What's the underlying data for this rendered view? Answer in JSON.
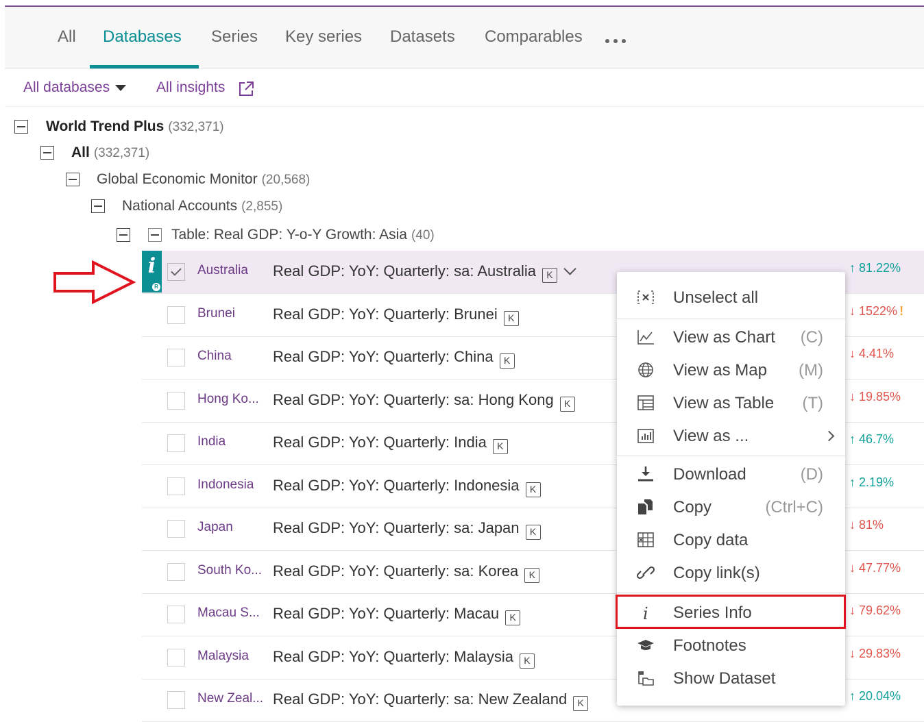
{
  "tabs": [
    {
      "label": "All",
      "active": false
    },
    {
      "label": "Databases",
      "active": true
    },
    {
      "label": "Series",
      "active": false
    },
    {
      "label": "Key series",
      "active": false
    },
    {
      "label": "Datasets",
      "active": false
    },
    {
      "label": "Comparables",
      "active": false
    }
  ],
  "filters": {
    "databases": "All databases",
    "insights": "All insights"
  },
  "tree": {
    "root": {
      "label": "World Trend Plus",
      "count": "(332,371)"
    },
    "all": {
      "label": "All",
      "count": "(332,371)"
    },
    "monitor": {
      "label": "Global Economic Monitor",
      "count": "(20,568)"
    },
    "accounts": {
      "label": "National Accounts",
      "count": "(2,855)"
    },
    "table": {
      "label": "Table: Real GDP: Y-o-Y Growth: Asia",
      "count": "(40)"
    }
  },
  "rows": [
    {
      "name": "Australia",
      "title": "Real GDP: YoY: Quarterly: sa: Australia",
      "badge": "K",
      "change": "81.22%",
      "direction": "up",
      "selected": true
    },
    {
      "name": "Brunei",
      "title": "Real GDP: YoY: Quarterly: Brunei",
      "badge": "K",
      "change": "1522%",
      "direction": "down",
      "warning": "!"
    },
    {
      "name": "China",
      "title": "Real GDP: YoY: Quarterly: China",
      "badge": "K",
      "change": "4.41%",
      "direction": "down"
    },
    {
      "name": "Hong Ko...",
      "title": "Real GDP: YoY: Quarterly: sa: Hong Kong",
      "badge": "K",
      "change": "19.85%",
      "direction": "down"
    },
    {
      "name": "India",
      "title": "Real GDP: YoY: Quarterly: India",
      "badge": "K",
      "change": "46.7%",
      "direction": "up"
    },
    {
      "name": "Indonesia",
      "title": "Real GDP: YoY: Quarterly: Indonesia",
      "badge": "K",
      "change": "2.19%",
      "direction": "up"
    },
    {
      "name": "Japan",
      "title": "Real GDP: YoY: Quarterly: sa: Japan",
      "badge": "K",
      "change": "81%",
      "direction": "down"
    },
    {
      "name": "South Ko...",
      "title": "Real GDP: YoY: Quarterly: sa: Korea",
      "badge": "K",
      "change": "47.77%",
      "direction": "down"
    },
    {
      "name": "Macau S...",
      "title": "Real GDP: YoY: Quarterly: Macau",
      "badge": "K",
      "change": "79.62%",
      "direction": "down"
    },
    {
      "name": "Malaysia",
      "title": "Real GDP: YoY: Quarterly: Malaysia",
      "badge": "K",
      "change": "29.83%",
      "direction": "down"
    },
    {
      "name": "New Zeal...",
      "title": "Real GDP: YoY: Quarterly: sa: New Zealand",
      "badge": "K",
      "change": "20.04%",
      "direction": "up"
    }
  ],
  "info_badge": {
    "icon": "i",
    "sub": "R"
  },
  "menu": {
    "unselect": {
      "label": "Unselect all",
      "icon": "unselect-icon"
    },
    "chart": {
      "label": "View as Chart",
      "shortcut": "(C)",
      "icon": "chart-icon"
    },
    "map": {
      "label": "View as Map",
      "shortcut": "(M)",
      "icon": "globe-icon"
    },
    "table": {
      "label": "View as Table",
      "shortcut": "(T)",
      "icon": "table-icon"
    },
    "viewas": {
      "label": "View as ...",
      "icon": "bar-chart-icon"
    },
    "download": {
      "label": "Download",
      "shortcut": "(D)",
      "icon": "download-icon"
    },
    "copy": {
      "label": "Copy",
      "shortcut": "(Ctrl+C)",
      "icon": "copy-icon"
    },
    "copydata": {
      "label": "Copy data",
      "icon": "spreadsheet-icon"
    },
    "copylink": {
      "label": "Copy link(s)",
      "icon": "link-icon"
    },
    "seriesinfo": {
      "label": "Series Info",
      "icon": "info-icon"
    },
    "footnotes": {
      "label": "Footnotes",
      "icon": "graduation-cap-icon"
    },
    "dataset": {
      "label": "Show Dataset",
      "icon": "dataset-icon"
    }
  },
  "colors": {
    "accent": "#0b8e94",
    "brand": "#7b3f98",
    "up": "#12a19a",
    "down": "#e0554b",
    "highlight": "#e0141e"
  }
}
